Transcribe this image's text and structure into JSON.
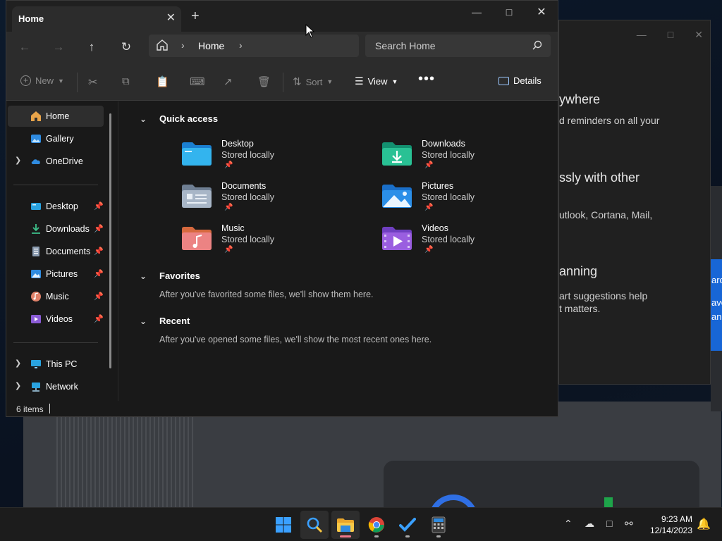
{
  "explorer": {
    "tab_title": "Home",
    "nav": {
      "breadcrumb": "Home"
    },
    "search_placeholder": "Search Home",
    "toolbar": {
      "new_label": "New",
      "sort_label": "Sort",
      "view_label": "View",
      "details_label": "Details"
    },
    "sidebar": {
      "top": [
        {
          "label": "Home"
        },
        {
          "label": "Gallery"
        },
        {
          "label": "OneDrive"
        }
      ],
      "pinned": [
        {
          "label": "Desktop"
        },
        {
          "label": "Downloads"
        },
        {
          "label": "Documents"
        },
        {
          "label": "Pictures"
        },
        {
          "label": "Music"
        },
        {
          "label": "Videos"
        }
      ],
      "bottom": [
        {
          "label": "This PC"
        },
        {
          "label": "Network"
        }
      ]
    },
    "quick_access": {
      "title": "Quick access",
      "items": [
        {
          "name": "Desktop",
          "sub": "Stored locally"
        },
        {
          "name": "Downloads",
          "sub": "Stored locally"
        },
        {
          "name": "Documents",
          "sub": "Stored locally"
        },
        {
          "name": "Pictures",
          "sub": "Stored locally"
        },
        {
          "name": "Music",
          "sub": "Stored locally"
        },
        {
          "name": "Videos",
          "sub": "Stored locally"
        }
      ]
    },
    "favorites": {
      "title": "Favorites",
      "message": "After you've favorited some files, we'll show them here."
    },
    "recent": {
      "title": "Recent",
      "message": "After you've opened some files, we'll show the most recent ones here."
    },
    "status": "6 items"
  },
  "background_window": {
    "lines": [
      "ywhere",
      "d reminders on all your",
      "ssly with other",
      "utlook, Cortana, Mail,",
      "anning",
      "art suggestions help",
      "t matters.",
      "aro",
      "ave",
      "an"
    ]
  },
  "taskbar": {
    "time": "9:23 AM",
    "date": "12/14/2023"
  },
  "colors": {
    "accent": "#0078d4",
    "window_bg": "#191919",
    "chrome_bg": "#2c2c2c"
  }
}
